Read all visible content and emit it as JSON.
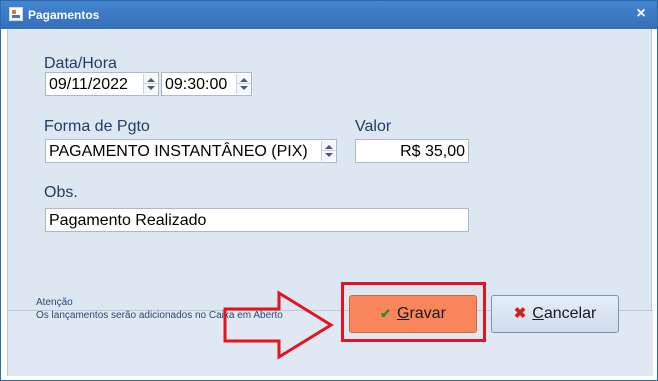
{
  "window": {
    "title": "Pagamentos",
    "close_symbol": "×"
  },
  "form": {
    "datetime_label": "Data/Hora",
    "date_value": "09/11/2022",
    "time_value": "09:30:00",
    "payment_method_label": "Forma de Pgto",
    "payment_method_value": "PAGAMENTO INSTANTÂNEO (PIX)",
    "value_label": "Valor",
    "value_value": "R$ 35,00",
    "obs_label": "Obs.",
    "obs_value": "Pagamento Realizado"
  },
  "footer": {
    "note_title": "Atenção",
    "note_text": "Os lançamentos serão adicionados no Caixa em Aberto"
  },
  "buttons": {
    "save_first": "G",
    "save_rest": "ravar",
    "cancel_first": "C",
    "cancel_rest": "ancelar"
  },
  "icons": {
    "save": "check-icon",
    "cancel": "x-icon",
    "app": "app-icon"
  },
  "colors": {
    "titlebar": "#3b79c2",
    "save_button": "#f9865a",
    "highlight": "#e4131f",
    "client_bg": "#dde7f2"
  }
}
